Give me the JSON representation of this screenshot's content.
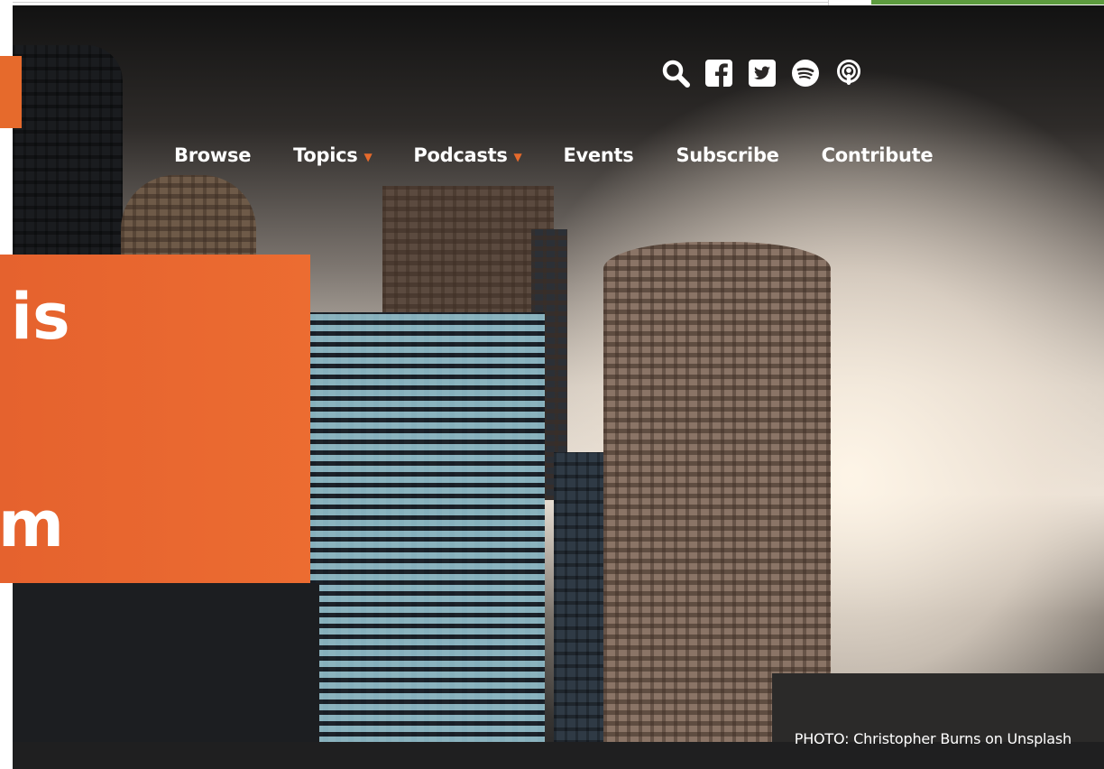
{
  "social": {
    "icons": [
      "search-icon",
      "facebook-icon",
      "twitter-icon",
      "spotify-icon",
      "apple-podcasts-icon"
    ]
  },
  "nav": {
    "items": [
      {
        "label": "Browse",
        "has_dropdown": false
      },
      {
        "label": "Topics",
        "has_dropdown": true
      },
      {
        "label": "Podcasts",
        "has_dropdown": true
      },
      {
        "label": "Events",
        "has_dropdown": false
      },
      {
        "label": "Subscribe",
        "has_dropdown": false
      },
      {
        "label": "Contribute",
        "has_dropdown": false
      }
    ],
    "caret": "▼"
  },
  "headline": {
    "line1": "is",
    "line2": "m"
  },
  "photo_credit": "PHOTO: Christopher Burns on Unsplash",
  "colors": {
    "accent": "#e66a2c",
    "nav_text": "#ffffff",
    "green_bar": "#5d9b3f"
  }
}
